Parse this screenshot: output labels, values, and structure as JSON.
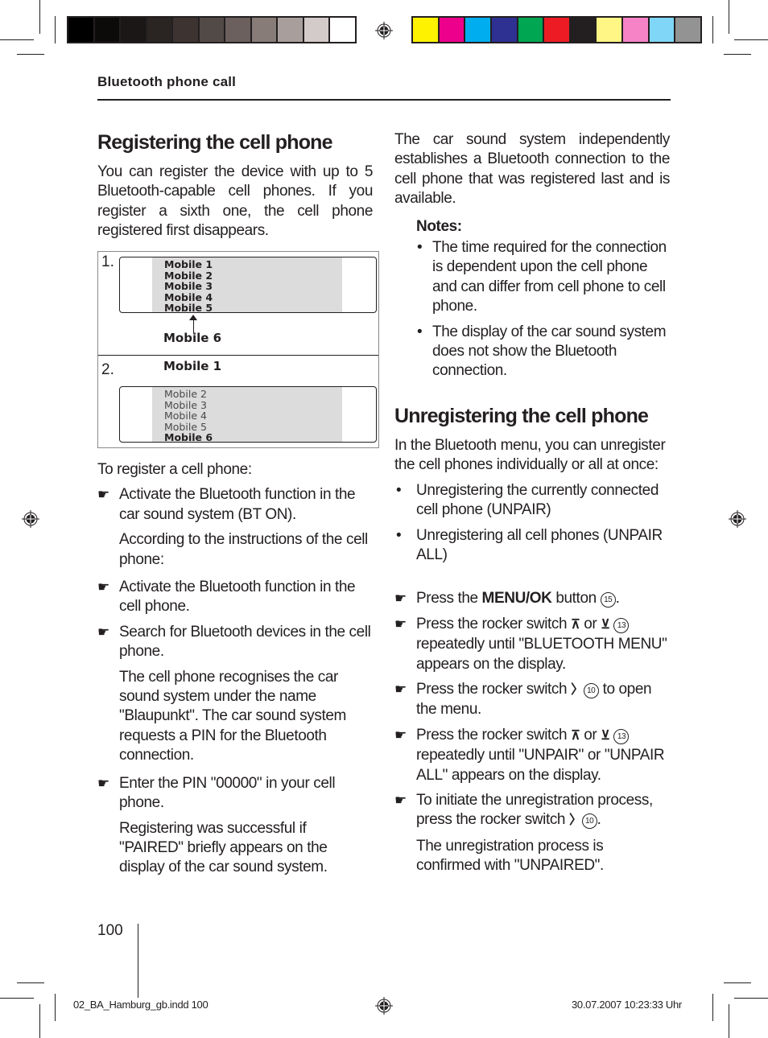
{
  "color_bars": {
    "grayscale": [
      "#000000",
      "#0d0b0a",
      "#1a1716",
      "#2a2523",
      "#3d3432",
      "#524a47",
      "#6b605d",
      "#877c78",
      "#a89f9c",
      "#d2cbca",
      "#ffffff"
    ],
    "process": [
      "#fff200",
      "#ec008c",
      "#00aeef",
      "#2e3192",
      "#00a651",
      "#ed1c24",
      "#231f20",
      "#fff685",
      "#f583c6",
      "#7fd6f7",
      "#939393"
    ]
  },
  "running_head": "Bluetooth phone call",
  "left": {
    "title": "Registering the cell phone",
    "intro": "You can register the device with up to 5 Bluetooth-capable cell phones. If you register a sixth one, the cell phone registered first disappears.",
    "figure": {
      "step1_num": "1.",
      "step1_list": [
        "Mobile 1",
        "Mobile 2",
        "Mobile 3",
        "Mobile 4",
        "Mobile 5"
      ],
      "step1_incoming": "Mobile 6",
      "step2_num": "2.",
      "step2_removed": "Mobile 1",
      "step2_list": [
        "Mobile 2",
        "Mobile 3",
        "Mobile 4",
        "Mobile 5",
        "Mobile 6"
      ]
    },
    "lead": "To register a cell phone:",
    "steps": [
      {
        "text": "Activate the Bluetooth function in the car sound system (BT ON).",
        "sub": "According to the instructions of the cell phone:"
      },
      {
        "text": "Activate the Bluetooth function in the cell phone.",
        "sub": ""
      },
      {
        "text": "Search for Bluetooth devices in the cell phone.",
        "sub": "The cell phone recognises the car sound system under the name \"Blaupunkt\". The car sound system requests a PIN for the Bluetooth connection."
      },
      {
        "text": "Enter the PIN \"00000\" in your cell phone.",
        "sub": "Registering was successful if \"PAIRED\" briefly appears on the display of the car sound system."
      }
    ]
  },
  "right": {
    "intro": "The car sound system independently establishes a Bluetooth connection to the cell phone that was registered last and is available.",
    "notes_title": "Notes:",
    "notes": [
      "The time required for the connection is dependent upon the cell phone and can differ from cell phone to cell phone.",
      "The display of the car sound system does not show the Bluetooth connection."
    ],
    "title": "Unregistering the cell phone",
    "intro2": "In the Bluetooth menu, you can unregister the cell phones individually or all at once:",
    "bullets": [
      "Unregistering the currently connected cell phone (UNPAIR)",
      "Unregistering all cell phones (UNPAIR ALL)"
    ],
    "steps": {
      "s1_pre": "Press the ",
      "s1_bold": "MENU/OK",
      "s1_post": " button ",
      "s1_ref": "15",
      "s1_end": ".",
      "s2_pre": "Press the rocker switch ",
      "s2_or": " or ",
      "s2_ref": "13",
      "s2_post": " repeatedly until \"BLUETOOTH MENU\" appears on the display.",
      "s3_pre": "Press the rocker switch ",
      "s3_ref": "10",
      "s3_post": " to open the menu.",
      "s4_pre": "Press the rocker switch ",
      "s4_or": " or ",
      "s4_ref": "13",
      "s4_post": " repeatedly until \"UNPAIR\" or \"UNPAIR ALL\" appears on the display.",
      "s5_pre": "To initiate the unregistration process, press the rocker switch ",
      "s5_ref": "10",
      "s5_end": ".",
      "s5_sub": "The unregistration process is confirmed with \"UNPAIRED\"."
    },
    "symbols": {
      "up": "⊼",
      "down": "⊻",
      "right": "〉"
    }
  },
  "icons": {
    "hand": "☛",
    "bullet": "•"
  },
  "page_number": "100",
  "slug_left": "02_BA_Hamburg_gb.indd   100",
  "slug_right": "30.07.2007   10:23:33 Uhr"
}
